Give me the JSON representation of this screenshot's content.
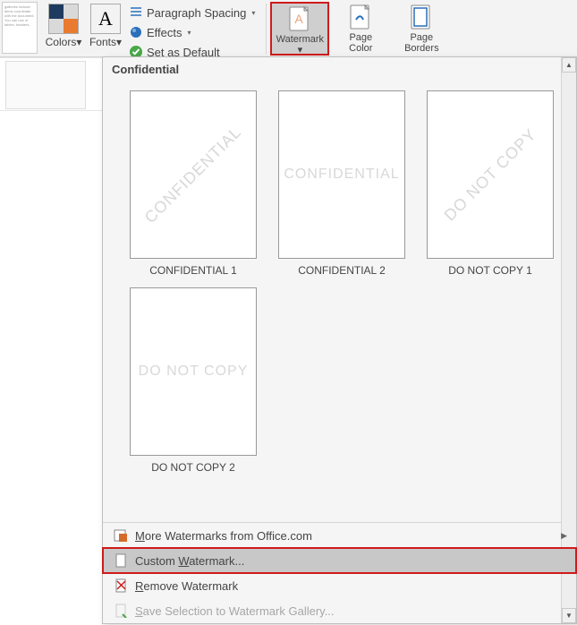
{
  "ribbon": {
    "gallery_thumb_text": "galleries include items coordinate with the document. You can use of tables, headers,",
    "colors_label": "Colors",
    "fonts_label": "Fonts",
    "fonts_glyph": "A",
    "paragraph_spacing": "Paragraph Spacing",
    "effects": "Effects",
    "set_default": "Set as Default",
    "watermark_label": "Watermark",
    "page_color_label": "Page\nColor",
    "page_borders_label": "Page\nBorders"
  },
  "dropdown": {
    "section_title": "Confidential",
    "thumbs": [
      {
        "text": "CONFIDENTIAL",
        "rot": true,
        "caption": "CONFIDENTIAL 1"
      },
      {
        "text": "CONFIDENTIAL",
        "rot": false,
        "caption": "CONFIDENTIAL 2"
      },
      {
        "text": "DO NOT COPY",
        "rot": true,
        "caption": "DO NOT COPY 1"
      },
      {
        "text": "DO NOT COPY",
        "rot": false,
        "caption": "DO NOT COPY 2"
      }
    ],
    "menu": {
      "more": "More Watermarks from Office.com",
      "custom": "Custom Watermark...",
      "remove": "Remove Watermark",
      "save": "Save Selection to Watermark Gallery..."
    }
  }
}
